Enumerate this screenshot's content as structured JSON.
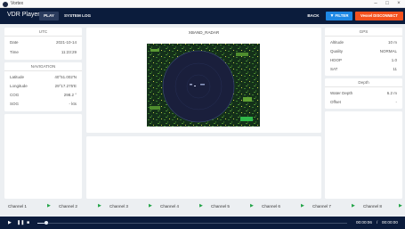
{
  "window": {
    "title": "Vortex"
  },
  "header": {
    "app_name": "VDR Player",
    "tabs": [
      "PLAY",
      "SYSTEM LOG"
    ],
    "back_label": "BACK",
    "filter_label": "FILTER",
    "disconnect_label": "Vessel DISCONNECT"
  },
  "utc": {
    "title": "UTC",
    "rows": [
      {
        "label": "Date",
        "value": "2021-10-14"
      },
      {
        "label": "Time",
        "value": "11:23:29"
      }
    ]
  },
  "navigation": {
    "title": "NAVIGATION",
    "rows": [
      {
        "label": "Latitude",
        "value": "40°51.002'N"
      },
      {
        "label": "Longitude",
        "value": "29°17.275'E"
      },
      {
        "label": "COG",
        "value": "298.2 °"
      },
      {
        "label": "SOG",
        "value": "- kts"
      }
    ]
  },
  "radar": {
    "title": "XBAND_RADAR"
  },
  "gps": {
    "title": "GPS",
    "rows": [
      {
        "label": "Altitude",
        "value": "10 m"
      },
      {
        "label": "Quality",
        "value": "NORMAL"
      },
      {
        "label": "HDOP",
        "value": "1.0"
      },
      {
        "label": "SAT",
        "value": "11"
      }
    ]
  },
  "depth": {
    "title": "Depth",
    "rows": [
      {
        "label": "Water Depth",
        "value": "6.2 m"
      },
      {
        "label": "Offset",
        "value": "-"
      }
    ]
  },
  "channels": [
    {
      "label": "Channel 1"
    },
    {
      "label": "Channel 2"
    },
    {
      "label": "Channel 3"
    },
    {
      "label": "Channel 4"
    },
    {
      "label": "Channel 5"
    },
    {
      "label": "Channel 6"
    },
    {
      "label": "Channel 7"
    },
    {
      "label": "Channel 8"
    }
  ],
  "player": {
    "current_time": "00:00:06",
    "separator": "/",
    "total_time": "00:00:00",
    "progress": 0.03
  },
  "colors": {
    "header_bg": "#0b1c3c",
    "filter": "#1e88e5",
    "disconnect": "#f4511e",
    "play_icon": "#22a447",
    "radar_bg": "#1a3517"
  }
}
